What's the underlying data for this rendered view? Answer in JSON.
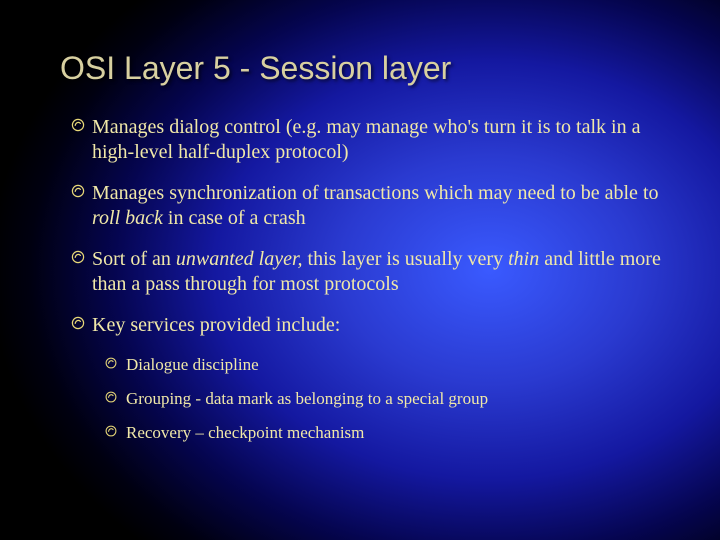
{
  "title": "OSI Layer 5 - Session layer",
  "bullets": [
    {
      "level": 1,
      "runs": [
        {
          "t": "Manages dialog control (e.g. may manage who's turn it is to talk in a high-level half-duplex protocol)",
          "i": false
        }
      ]
    },
    {
      "level": 1,
      "runs": [
        {
          "t": "Manages synchronization of transactions which may need to be able to ",
          "i": false
        },
        {
          "t": "roll back",
          "i": true
        },
        {
          "t": " in case of a crash",
          "i": false
        }
      ]
    },
    {
      "level": 1,
      "runs": [
        {
          "t": "Sort of an ",
          "i": false
        },
        {
          "t": "unwanted layer,",
          "i": true
        },
        {
          "t": " this layer is usually very ",
          "i": false
        },
        {
          "t": "thin",
          "i": true
        },
        {
          "t": " and little more than a pass through for most protocols",
          "i": false
        }
      ]
    },
    {
      "level": 1,
      "runs": [
        {
          "t": "Key services provided include:",
          "i": false
        }
      ]
    },
    {
      "level": 2,
      "runs": [
        {
          "t": "Dialogue discipline",
          "i": false
        }
      ]
    },
    {
      "level": 2,
      "runs": [
        {
          "t": "Grouping  - data mark as belonging to a special group",
          "i": false
        }
      ]
    },
    {
      "level": 2,
      "runs": [
        {
          "t": "Recovery – checkpoint mechanism",
          "i": false
        }
      ]
    }
  ]
}
